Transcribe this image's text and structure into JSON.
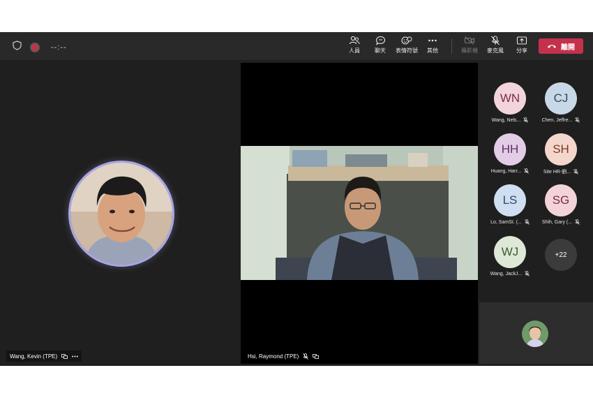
{
  "topbar": {
    "timer": "--:--",
    "tools": [
      {
        "label": "人員",
        "icon": "people-icon"
      },
      {
        "label": "聊天",
        "icon": "chat-icon"
      },
      {
        "label": "表情符號",
        "icon": "emoji-icon"
      },
      {
        "label": "其他",
        "icon": "more-icon"
      },
      {
        "label": "攝影機",
        "icon": "camera-off-icon"
      },
      {
        "label": "麥克風",
        "icon": "mic-off-icon"
      },
      {
        "label": "分享",
        "icon": "share-icon"
      }
    ],
    "leave_label": "離開"
  },
  "stage": {
    "left_participant": "Wang, Kevin (TPE)",
    "center_participant": "Hsi, Raymond (TPE)"
  },
  "roster": [
    {
      "initials": "WN",
      "name": "Wang, Nels...",
      "color": "#f2d5dc",
      "text": "#7a2f43"
    },
    {
      "initials": "CJ",
      "name": "Chen, Jeffre...",
      "color": "#c9d8e6",
      "text": "#2f4a62"
    },
    {
      "initials": "HH",
      "name": "Huang, Harr...",
      "color": "#e3cde6",
      "text": "#5a3267"
    },
    {
      "initials": "SH",
      "name": "Site HR-劉...",
      "color": "#f5d6cc",
      "text": "#7a3a24"
    },
    {
      "initials": "LS",
      "name": "Lo, SamSI. (...",
      "color": "#cfdef0",
      "text": "#2c4a70"
    },
    {
      "initials": "SG",
      "name": "Shih, Gary (...",
      "color": "#f3d3da",
      "text": "#7a2d40"
    },
    {
      "initials": "WJ",
      "name": "Wang, JackJ...",
      "color": "#dde8d6",
      "text": "#3b5a32"
    }
  ],
  "overflow_count": "+22"
}
